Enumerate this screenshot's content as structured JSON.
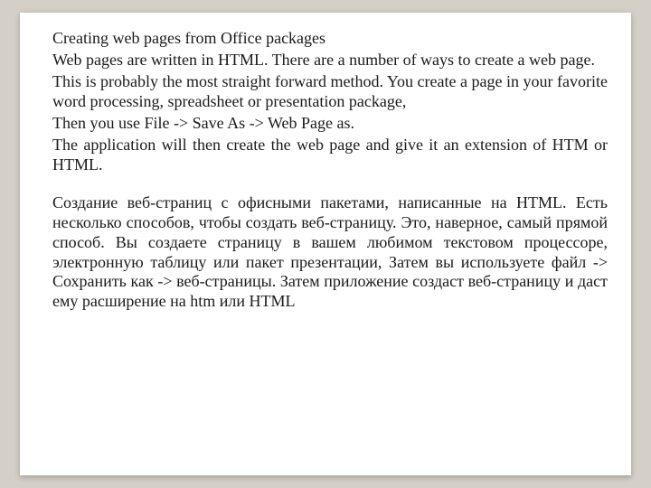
{
  "slide": {
    "en": {
      "p1": "Creating web pages from Office packages",
      "p2": "Web pages are written in HTML. There are a number of ways to create a web page.",
      "p3": "This is probably the most straight forward method. You create a page in your favorite word processing, spreadsheet or presentation package,",
      "p4": "Then you use File -> Save As -> Web Page as.",
      "p5": "The application will then create the web page and give it an extension of HTM or HTML."
    },
    "ru": {
      "p1": "Создание веб-страниц с офисными пакетами, написанные на HTML. Есть несколько способов, чтобы создать веб-страницу. Это, наверное, самый прямой способ. Вы создаете страницу в вашем любимом текстовом процессоре, электронную таблицу или пакет презентации, Затем вы используете файл -> Сохранить как -> веб-страницы. Затем приложение создаст веб-страницу и даст ему расширение на htm или HTML"
    }
  }
}
